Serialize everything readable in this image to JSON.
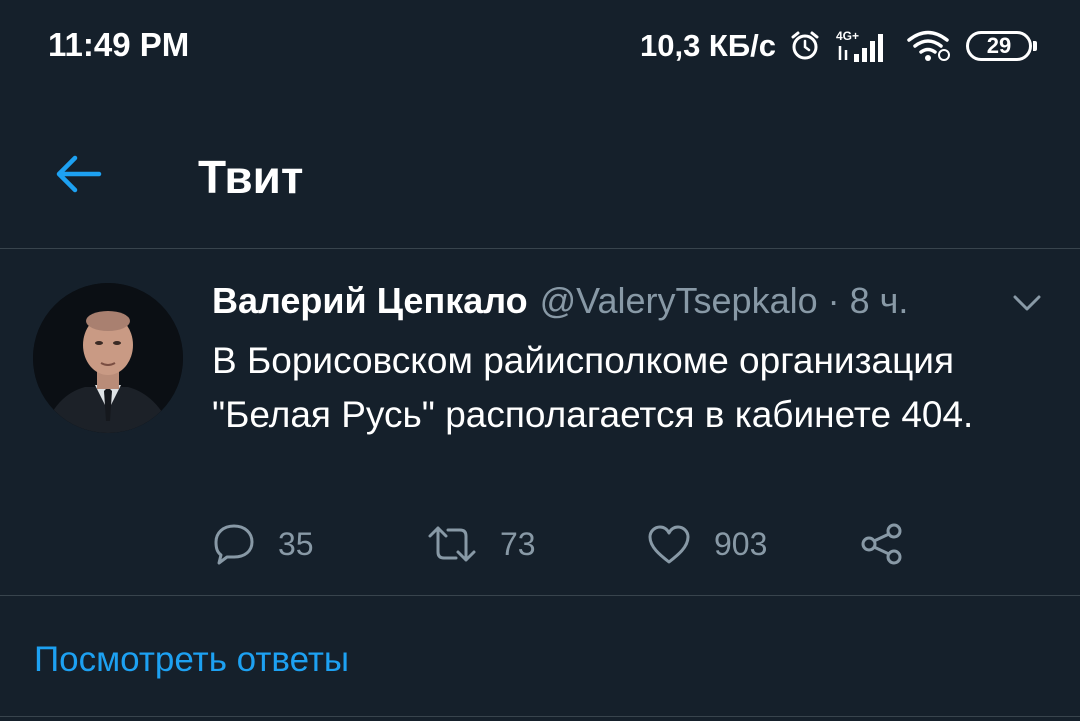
{
  "statusbar": {
    "time": "11:49 PM",
    "speed": "10,3 КБ/с",
    "network": "4G+",
    "battery": "29",
    "icons": [
      "alarm-icon",
      "signal-icon",
      "wifi-icon",
      "battery-icon"
    ]
  },
  "header": {
    "title": "Твит",
    "back_icon": "arrow-left-icon"
  },
  "tweet": {
    "author_name": "Валерий Цепкало",
    "author_handle": "@ValeryTsepkalo",
    "separator": "·",
    "time_ago": "8 ч.",
    "text": "В Борисовском райисполкоме организация \"Белая Русь\" располагается в кабинете 404.",
    "actions": {
      "reply_count": "35",
      "retweet_count": "73",
      "like_count": "903"
    }
  },
  "footer": {
    "view_replies": "Посмотреть ответы"
  },
  "colors": {
    "background": "#15202b",
    "accent": "#1da1f2",
    "secondary_text": "#8899a6",
    "divider": "#38444d"
  }
}
